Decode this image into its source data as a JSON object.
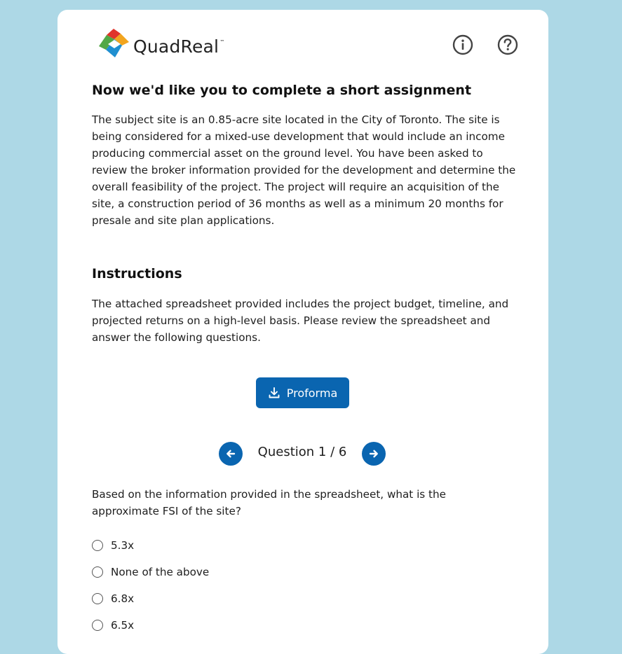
{
  "brand": {
    "name": "QuadReal",
    "tm": "™"
  },
  "header": {
    "icons": [
      "info-icon",
      "help-icon"
    ]
  },
  "intro": {
    "title": "Now we'd like you to complete a short assignment",
    "body": "The subject site is an 0.85-acre site located in the City of Toronto. The site is being considered for a mixed-use development that would include an income producing commercial asset on the ground level. You have been asked to review the broker information provided for the development and determine the overall feasibility of the project. The project will require an acquisition of the site, a construction period of 36 months as well as a minimum 20 months for presale and site plan applications."
  },
  "instructions": {
    "title": "Instructions",
    "body": "The attached spreadsheet provided includes the project budget, timeline, and projected returns on a high-level basis. Please review the spreadsheet and answer the following questions."
  },
  "download": {
    "label": "Proforma",
    "icon": "download-icon"
  },
  "pager": {
    "label": "Question 1 / 6",
    "current": 1,
    "total": 6
  },
  "question": {
    "text": "Based on the information provided in the spreadsheet, what is the approximate FSI of the site?",
    "options": [
      "5.3x",
      "None of the above",
      "6.8x",
      "6.5x"
    ]
  },
  "colors": {
    "background": "#add8e6",
    "card": "#ffffff",
    "accent": "#0a65b0"
  }
}
